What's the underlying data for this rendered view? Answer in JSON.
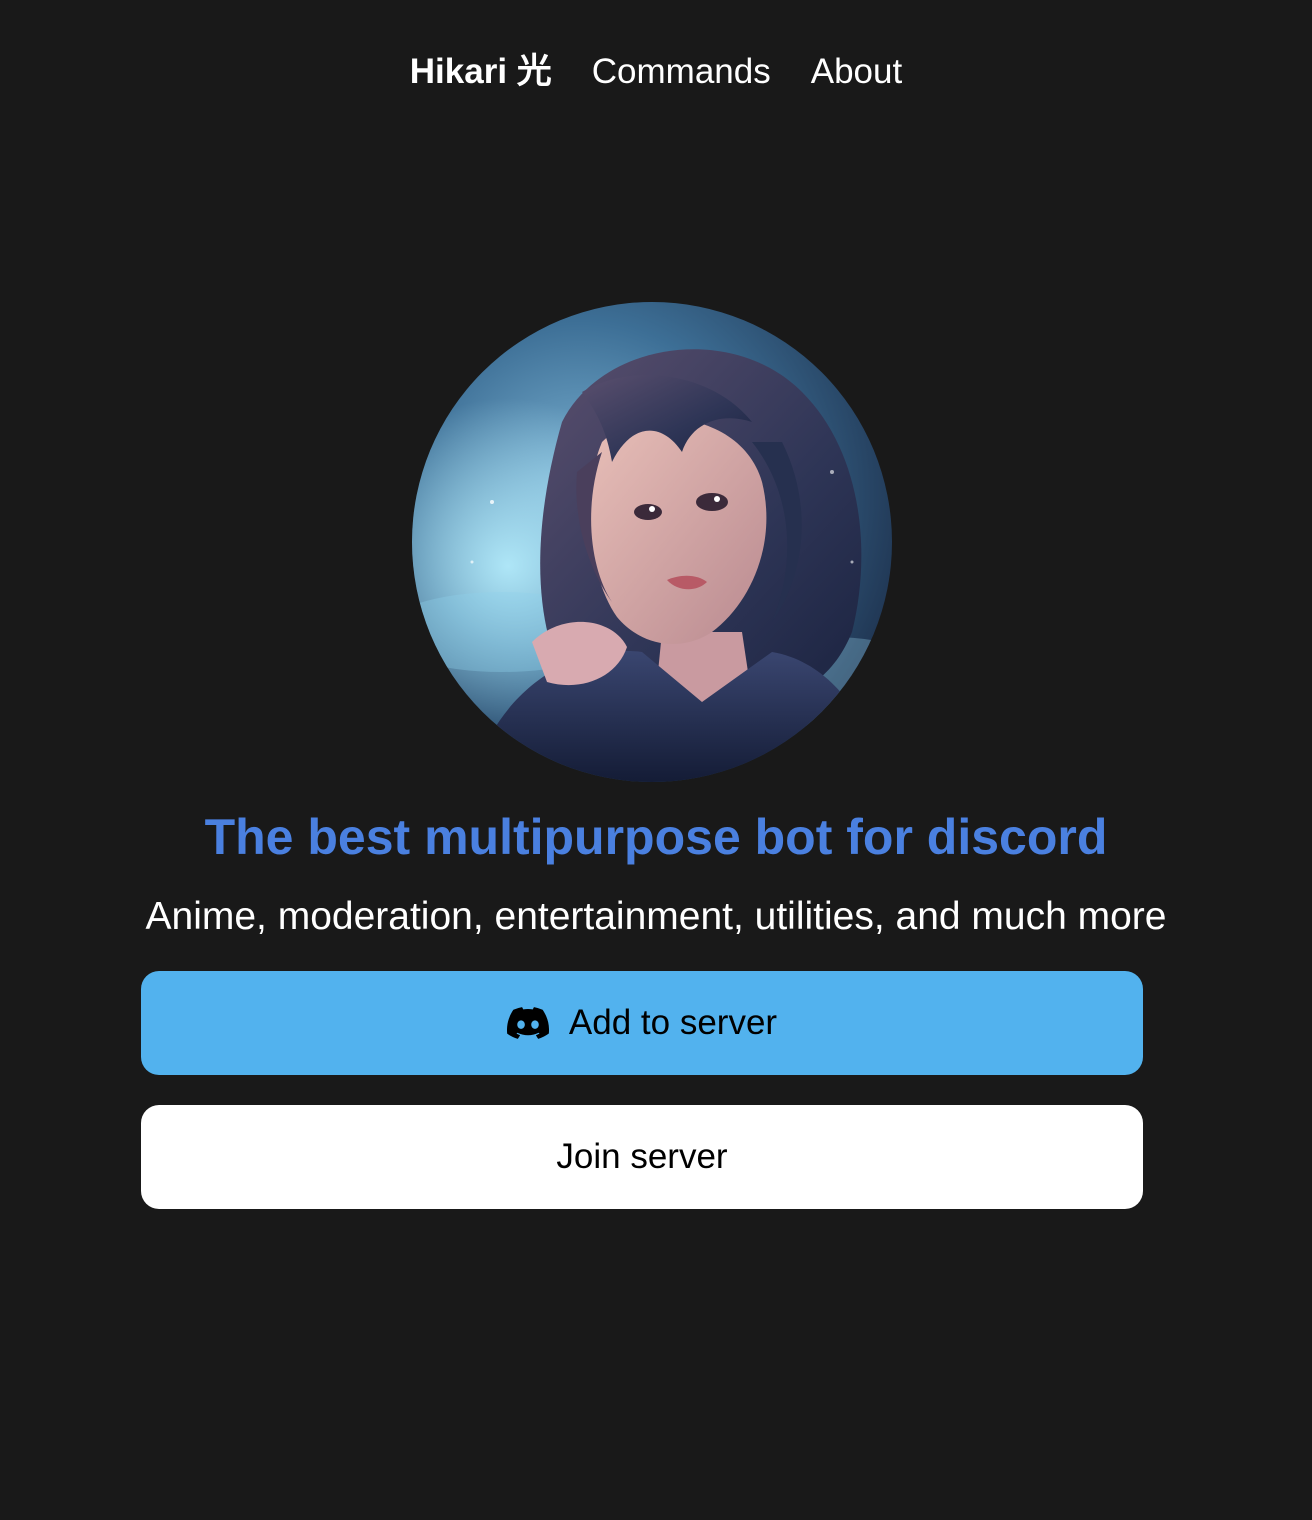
{
  "nav": {
    "brand": "Hikari 光",
    "links": [
      {
        "label": "Commands"
      },
      {
        "label": "About"
      }
    ]
  },
  "hero": {
    "avatar_alt": "Hikari avatar",
    "headline": "The best multipurpose bot for discord",
    "subline": "Anime, moderation, entertainment, utilities, and much more"
  },
  "actions": {
    "add_label": "Add to server",
    "add_icon": "discord-icon",
    "join_label": "Join server"
  },
  "colors": {
    "background": "#191919",
    "headline": "#4a80e0",
    "add_button": "#52b2ee",
    "join_button": "#ffffff"
  }
}
